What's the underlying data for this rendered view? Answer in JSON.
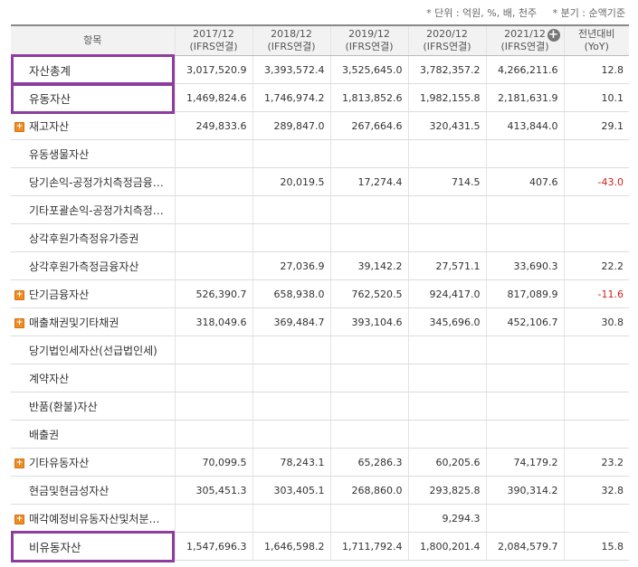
{
  "units_note": "* 단위 : 억원, %, 배, 천주",
  "period_note": "* 분기 : 순액기준",
  "header": {
    "item": "항목",
    "cols": [
      {
        "year": "2017/12",
        "basis": "(IFRS연결)"
      },
      {
        "year": "2018/12",
        "basis": "(IFRS연결)"
      },
      {
        "year": "2019/12",
        "basis": "(IFRS연결)"
      },
      {
        "year": "2020/12",
        "basis": "(IFRS연결)"
      },
      {
        "year": "2021/12",
        "basis": "(IFRS연결)"
      }
    ],
    "yoy_top": "전년대비",
    "yoy_bottom": "(YoY)"
  },
  "rows": [
    {
      "label": "자산총계",
      "expandable": false,
      "highlight": true,
      "values": [
        "3,017,520.9",
        "3,393,572.4",
        "3,525,645.0",
        "3,782,357.2",
        "4,266,211.6",
        "12.8"
      ]
    },
    {
      "label": "유동자산",
      "expandable": false,
      "highlight": true,
      "values": [
        "1,469,824.6",
        "1,746,974.2",
        "1,813,852.6",
        "1,982,155.8",
        "2,181,631.9",
        "10.1"
      ]
    },
    {
      "label": "재고자산",
      "expandable": true,
      "values": [
        "249,833.6",
        "289,847.0",
        "267,664.6",
        "320,431.5",
        "413,844.0",
        "29.1"
      ]
    },
    {
      "label": "유동생물자산",
      "expandable": false,
      "values": [
        "",
        "",
        "",
        "",
        "",
        ""
      ]
    },
    {
      "label": "당기손익-공정가치측정금융…",
      "expandable": false,
      "values": [
        "",
        "20,019.5",
        "17,274.4",
        "714.5",
        "407.6",
        "-43.0"
      ]
    },
    {
      "label": "기타포괄손익-공정가치측정…",
      "expandable": false,
      "values": [
        "",
        "",
        "",
        "",
        "",
        ""
      ]
    },
    {
      "label": "상각후원가측정유가증권",
      "expandable": false,
      "values": [
        "",
        "",
        "",
        "",
        "",
        ""
      ]
    },
    {
      "label": "상각후원가측정금융자산",
      "expandable": false,
      "values": [
        "",
        "27,036.9",
        "39,142.2",
        "27,571.1",
        "33,690.3",
        "22.2"
      ]
    },
    {
      "label": "단기금융자산",
      "expandable": true,
      "values": [
        "526,390.7",
        "658,938.0",
        "762,520.5",
        "924,417.0",
        "817,089.9",
        "-11.6"
      ]
    },
    {
      "label": "매출채권및기타채권",
      "expandable": true,
      "values": [
        "318,049.6",
        "369,484.7",
        "393,104.6",
        "345,696.0",
        "452,106.7",
        "30.8"
      ]
    },
    {
      "label": "당기법인세자산(선급법인세)",
      "expandable": false,
      "values": [
        "",
        "",
        "",
        "",
        "",
        ""
      ]
    },
    {
      "label": "계약자산",
      "expandable": false,
      "values": [
        "",
        "",
        "",
        "",
        "",
        ""
      ]
    },
    {
      "label": "반품(환불)자산",
      "expandable": false,
      "values": [
        "",
        "",
        "",
        "",
        "",
        ""
      ]
    },
    {
      "label": "배출권",
      "expandable": false,
      "values": [
        "",
        "",
        "",
        "",
        "",
        ""
      ]
    },
    {
      "label": "기타유동자산",
      "expandable": true,
      "values": [
        "70,099.5",
        "78,243.1",
        "65,286.3",
        "60,205.6",
        "74,179.2",
        "23.2"
      ]
    },
    {
      "label": "현금및현금성자산",
      "expandable": false,
      "values": [
        "305,451.3",
        "303,405.1",
        "268,860.0",
        "293,825.8",
        "390,314.2",
        "32.8"
      ]
    },
    {
      "label": "매각예정비유동자산및처분…",
      "expandable": true,
      "values": [
        "",
        "",
        "",
        "9,294.3",
        "",
        ""
      ]
    },
    {
      "label": "비유동자산",
      "expandable": false,
      "highlight": true,
      "values": [
        "1,547,696.3",
        "1,646,598.2",
        "1,711,792.4",
        "1,800,201.4",
        "2,084,579.7",
        "15.8"
      ]
    }
  ],
  "colors": {
    "highlight": "#8c3d9e",
    "negative": "#d21e1e",
    "expand_icon": "#f08c24"
  }
}
